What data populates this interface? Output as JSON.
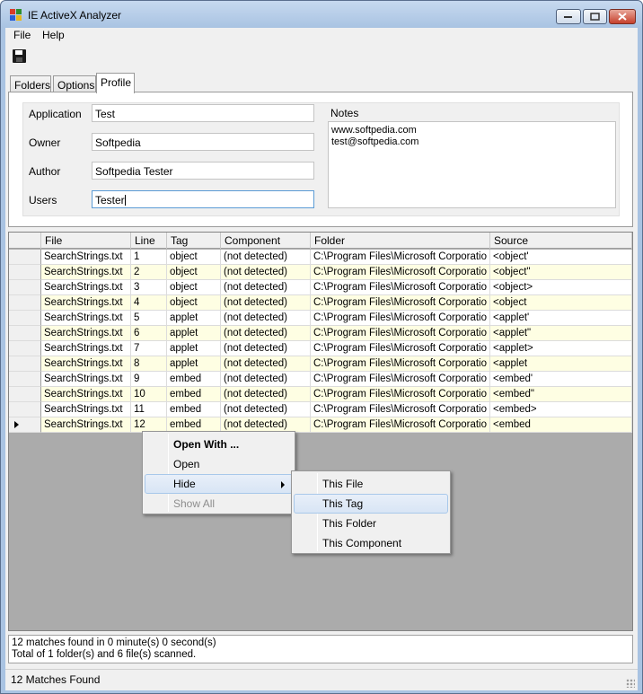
{
  "window": {
    "title": "IE ActiveX Analyzer"
  },
  "menu": {
    "file": "File",
    "help": "Help"
  },
  "toolbar": {
    "save_icon": "save-icon"
  },
  "tabs": [
    {
      "label": "Folders",
      "active": false
    },
    {
      "label": "Options",
      "active": false
    },
    {
      "label": "Profile",
      "active": true
    }
  ],
  "profile": {
    "application_label": "Application",
    "application_value": "Test",
    "owner_label": "Owner",
    "owner_value": "Softpedia",
    "author_label": "Author",
    "author_value": "Softpedia Tester",
    "users_label": "Users",
    "users_value": "Tester",
    "notes_label": "Notes",
    "notes_lines": [
      "www.softpedia.com",
      "test@softpedia.com"
    ]
  },
  "grid": {
    "columns": [
      "File",
      "Line",
      "Tag",
      "Component",
      "Folder",
      "Source"
    ],
    "rows": [
      [
        "SearchStrings.txt",
        "1",
        "object",
        "(not detected)",
        "C:\\Program Files\\Microsoft Corporatio",
        "<object'"
      ],
      [
        "SearchStrings.txt",
        "2",
        "object",
        "(not detected)",
        "C:\\Program Files\\Microsoft Corporatio",
        "<object\""
      ],
      [
        "SearchStrings.txt",
        "3",
        "object",
        "(not detected)",
        "C:\\Program Files\\Microsoft Corporatio",
        "<object>"
      ],
      [
        "SearchStrings.txt",
        "4",
        "object",
        "(not detected)",
        "C:\\Program Files\\Microsoft Corporatio",
        "<object"
      ],
      [
        "SearchStrings.txt",
        "5",
        "applet",
        "(not detected)",
        "C:\\Program Files\\Microsoft Corporatio",
        "<applet'"
      ],
      [
        "SearchStrings.txt",
        "6",
        "applet",
        "(not detected)",
        "C:\\Program Files\\Microsoft Corporatio",
        "<applet\""
      ],
      [
        "SearchStrings.txt",
        "7",
        "applet",
        "(not detected)",
        "C:\\Program Files\\Microsoft Corporatio",
        "<applet>"
      ],
      [
        "SearchStrings.txt",
        "8",
        "applet",
        "(not detected)",
        "C:\\Program Files\\Microsoft Corporatio",
        "<applet"
      ],
      [
        "SearchStrings.txt",
        "9",
        "embed",
        "(not detected)",
        "C:\\Program Files\\Microsoft Corporatio",
        "<embed'"
      ],
      [
        "SearchStrings.txt",
        "10",
        "embed",
        "(not detected)",
        "C:\\Program Files\\Microsoft Corporatio",
        "<embed\""
      ],
      [
        "SearchStrings.txt",
        "11",
        "embed",
        "(not detected)",
        "C:\\Program Files\\Microsoft Corporatio",
        "<embed>"
      ],
      [
        "SearchStrings.txt",
        "12",
        "embed",
        "(not detected)",
        "C:\\Program Files\\Microsoft Corporatio",
        "<embed"
      ]
    ],
    "current_row": 11
  },
  "context_menu": {
    "items": [
      {
        "label": "Open With ...",
        "bold": true,
        "disabled": false,
        "submenu": false
      },
      {
        "label": "Open",
        "bold": false,
        "disabled": false,
        "submenu": false
      },
      {
        "label": "Hide",
        "bold": false,
        "disabled": false,
        "submenu": true,
        "highlight": true
      },
      {
        "label": "Show All",
        "bold": false,
        "disabled": true,
        "submenu": false
      }
    ]
  },
  "submenu": {
    "items": [
      {
        "label": "This File",
        "highlight": false
      },
      {
        "label": "This Tag",
        "highlight": true
      },
      {
        "label": "This Folder",
        "highlight": false
      },
      {
        "label": "This Component",
        "highlight": false
      }
    ]
  },
  "log": {
    "line1": "12 matches found in 0 minute(s) 0 second(s)",
    "line2": "Total of 1 folder(s) and 6 file(s) scanned."
  },
  "status": {
    "text": "12 Matches Found"
  },
  "colors": {
    "alt_row": "#fefee3",
    "highlight": "#d8e5f5",
    "grid_bg": "#ababab"
  }
}
